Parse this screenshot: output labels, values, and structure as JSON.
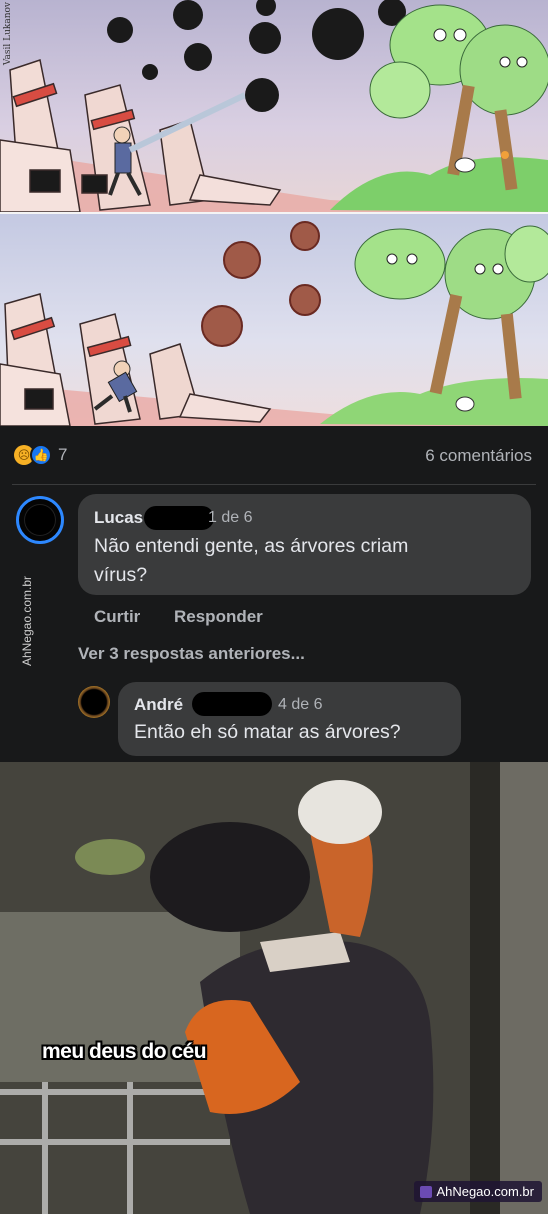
{
  "comic": {
    "signature": "Vasil Lukanov"
  },
  "post": {
    "reaction_icons": [
      "sad-face-icon",
      "thumbs-up-icon"
    ],
    "reaction_count": "7",
    "comments_count": "6 comentários"
  },
  "comments": [
    {
      "name": "Lucas",
      "time": "1 de 6",
      "text_line1": "Não entendi gente, as árvores criam",
      "text_line2": "vírus?",
      "like_label": "Curtir",
      "reply_label": "Responder"
    }
  ],
  "view_more": "Ver 3 respostas anteriores...",
  "reply": {
    "name": "André",
    "time": "4 de 6",
    "text": "Então eh só matar as árvores?"
  },
  "watermark_side": "AhNegao.com.br",
  "meme": {
    "caption": "meu deus do céu",
    "watermark": "AhNegao.com.br"
  },
  "colors": {
    "fb_background": "#18191a",
    "bubble": "#3a3b3c",
    "like_blue": "#1877f2",
    "avatar_ring": "#2d88ff"
  }
}
